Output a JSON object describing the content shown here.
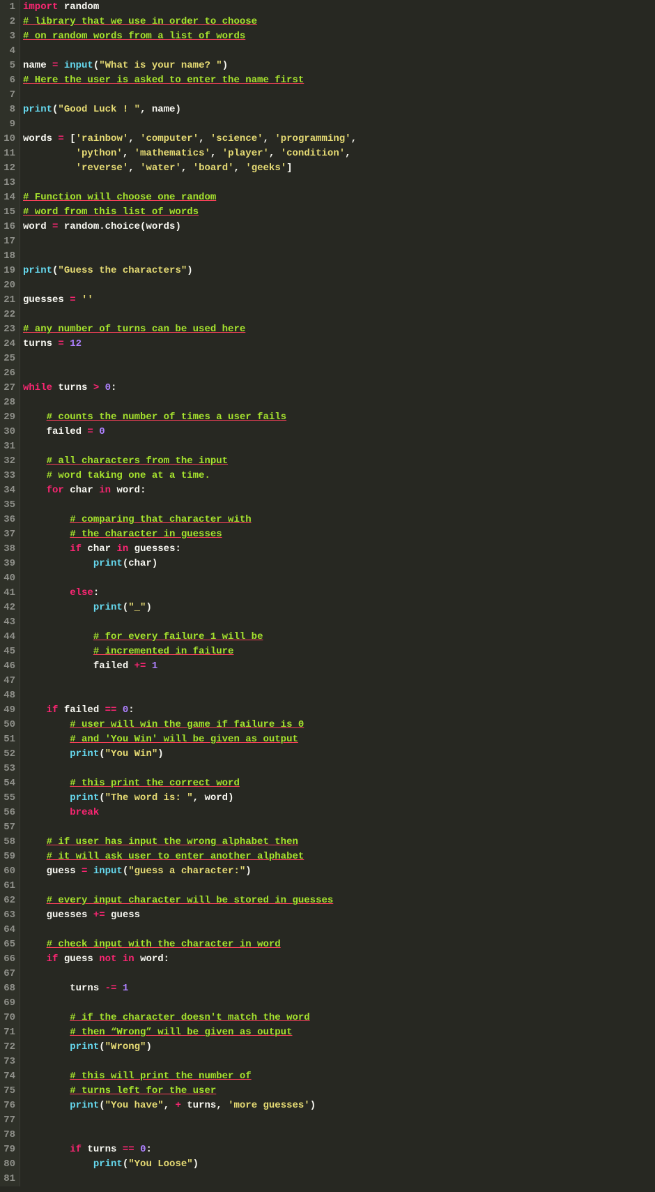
{
  "lines": [
    [
      [
        "import",
        "kw"
      ],
      [
        " random",
        "id"
      ]
    ],
    [
      [
        "# library that we use in order to choose",
        "sq"
      ]
    ],
    [
      [
        "# on random words from a list of words",
        "sq"
      ]
    ],
    [],
    [
      [
        "name ",
        "id"
      ],
      [
        "=",
        "op"
      ],
      [
        " ",
        "id"
      ],
      [
        "input",
        "fn"
      ],
      [
        "(",
        "id"
      ],
      [
        "\"What is your name? \"",
        "str"
      ],
      [
        ")",
        "id"
      ]
    ],
    [
      [
        "# Here the user is asked to enter the name first",
        "sq"
      ]
    ],
    [],
    [
      [
        "print",
        "fn"
      ],
      [
        "(",
        "id"
      ],
      [
        "\"Good Luck ! \"",
        "str"
      ],
      [
        ", name)",
        "id"
      ]
    ],
    [],
    [
      [
        "words ",
        "id"
      ],
      [
        "=",
        "op"
      ],
      [
        " [",
        "id"
      ],
      [
        "'rainbow'",
        "str"
      ],
      [
        ", ",
        "id"
      ],
      [
        "'computer'",
        "str"
      ],
      [
        ", ",
        "id"
      ],
      [
        "'science'",
        "str"
      ],
      [
        ", ",
        "id"
      ],
      [
        "'programming'",
        "str"
      ],
      [
        ",",
        "id"
      ]
    ],
    [
      [
        "         ",
        "id"
      ],
      [
        "'python'",
        "str"
      ],
      [
        ", ",
        "id"
      ],
      [
        "'mathematics'",
        "str"
      ],
      [
        ", ",
        "id"
      ],
      [
        "'player'",
        "str"
      ],
      [
        ", ",
        "id"
      ],
      [
        "'condition'",
        "str"
      ],
      [
        ",",
        "id"
      ]
    ],
    [
      [
        "         ",
        "id"
      ],
      [
        "'reverse'",
        "str"
      ],
      [
        ", ",
        "id"
      ],
      [
        "'water'",
        "str"
      ],
      [
        ", ",
        "id"
      ],
      [
        "'board'",
        "str"
      ],
      [
        ", ",
        "id"
      ],
      [
        "'geeks'",
        "str"
      ],
      [
        "]",
        "id"
      ]
    ],
    [],
    [
      [
        "# Function will choose one random",
        "sq"
      ]
    ],
    [
      [
        "# word from this list of words",
        "sq"
      ]
    ],
    [
      [
        "word ",
        "id"
      ],
      [
        "=",
        "op"
      ],
      [
        " random.choice(words)",
        "id"
      ]
    ],
    [],
    [],
    [
      [
        "print",
        "fn"
      ],
      [
        "(",
        "id"
      ],
      [
        "\"Guess the characters\"",
        "str"
      ],
      [
        ")",
        "id"
      ]
    ],
    [],
    [
      [
        "guesses ",
        "id"
      ],
      [
        "=",
        "op"
      ],
      [
        " ",
        "id"
      ],
      [
        "''",
        "str"
      ]
    ],
    [],
    [
      [
        "# any number of turns can be used here",
        "sq"
      ]
    ],
    [
      [
        "turns ",
        "id"
      ],
      [
        "=",
        "op"
      ],
      [
        " ",
        "id"
      ],
      [
        "12",
        "num"
      ]
    ],
    [],
    [],
    [
      [
        "while",
        "kw"
      ],
      [
        " turns ",
        "id"
      ],
      [
        ">",
        "op"
      ],
      [
        " ",
        "id"
      ],
      [
        "0",
        "num"
      ],
      [
        ":",
        "id"
      ]
    ],
    [],
    [
      [
        "    ",
        "id"
      ],
      [
        "# counts the number of times a user fails",
        "sq"
      ]
    ],
    [
      [
        "    failed ",
        "id"
      ],
      [
        "=",
        "op"
      ],
      [
        " ",
        "id"
      ],
      [
        "0",
        "num"
      ]
    ],
    [],
    [
      [
        "    ",
        "id"
      ],
      [
        "# all characters from the input",
        "sq"
      ]
    ],
    [
      [
        "    ",
        "id"
      ],
      [
        "# word taking one at a time.",
        "sq2"
      ]
    ],
    [
      [
        "    ",
        "id"
      ],
      [
        "for",
        "kw"
      ],
      [
        " char ",
        "id"
      ],
      [
        "in",
        "kw"
      ],
      [
        " word:",
        "id"
      ]
    ],
    [],
    [
      [
        "        ",
        "id"
      ],
      [
        "# comparing that character with",
        "sq"
      ]
    ],
    [
      [
        "        ",
        "id"
      ],
      [
        "# the character in guesses",
        "sq"
      ]
    ],
    [
      [
        "        ",
        "id"
      ],
      [
        "if",
        "kw"
      ],
      [
        " char ",
        "id"
      ],
      [
        "in",
        "kw"
      ],
      [
        " guesses:",
        "id"
      ]
    ],
    [
      [
        "            ",
        "id"
      ],
      [
        "print",
        "fn"
      ],
      [
        "(char)",
        "id"
      ]
    ],
    [],
    [
      [
        "        ",
        "id"
      ],
      [
        "else",
        "kw"
      ],
      [
        ":",
        "id"
      ]
    ],
    [
      [
        "            ",
        "id"
      ],
      [
        "print",
        "fn"
      ],
      [
        "(",
        "id"
      ],
      [
        "\"_\"",
        "str"
      ],
      [
        ")",
        "id"
      ]
    ],
    [],
    [
      [
        "            ",
        "id"
      ],
      [
        "# for every failure 1 will be",
        "sq"
      ]
    ],
    [
      [
        "            ",
        "id"
      ],
      [
        "# incremented in failure",
        "sq"
      ]
    ],
    [
      [
        "            failed ",
        "id"
      ],
      [
        "+=",
        "op"
      ],
      [
        " ",
        "id"
      ],
      [
        "1",
        "num"
      ]
    ],
    [],
    [],
    [
      [
        "    ",
        "id"
      ],
      [
        "if",
        "kw"
      ],
      [
        " failed ",
        "id"
      ],
      [
        "==",
        "op"
      ],
      [
        " ",
        "id"
      ],
      [
        "0",
        "num"
      ],
      [
        ":",
        "id"
      ]
    ],
    [
      [
        "        ",
        "id"
      ],
      [
        "# user will win the game if failure is 0",
        "sq"
      ]
    ],
    [
      [
        "        ",
        "id"
      ],
      [
        "# and 'You Win' will be given as output",
        "sq"
      ]
    ],
    [
      [
        "        ",
        "id"
      ],
      [
        "print",
        "fn"
      ],
      [
        "(",
        "id"
      ],
      [
        "\"You Win\"",
        "str"
      ],
      [
        ")",
        "id"
      ]
    ],
    [],
    [
      [
        "        ",
        "id"
      ],
      [
        "# this print the correct word",
        "sq"
      ]
    ],
    [
      [
        "        ",
        "id"
      ],
      [
        "print",
        "fn"
      ],
      [
        "(",
        "id"
      ],
      [
        "\"The word is: \"",
        "str"
      ],
      [
        ", word)",
        "id"
      ]
    ],
    [
      [
        "        ",
        "id"
      ],
      [
        "break",
        "kw"
      ]
    ],
    [],
    [
      [
        "    ",
        "id"
      ],
      [
        "# if user has input the wrong alphabet then",
        "sq"
      ]
    ],
    [
      [
        "    ",
        "id"
      ],
      [
        "# it will ask user to enter another alphabet",
        "sq"
      ]
    ],
    [
      [
        "    guess ",
        "id"
      ],
      [
        "=",
        "op"
      ],
      [
        " ",
        "id"
      ],
      [
        "input",
        "fn"
      ],
      [
        "(",
        "id"
      ],
      [
        "\"guess a character:\"",
        "str"
      ],
      [
        ")",
        "id"
      ]
    ],
    [],
    [
      [
        "    ",
        "id"
      ],
      [
        "# every input character will be stored in guesses",
        "sq"
      ]
    ],
    [
      [
        "    guesses ",
        "id"
      ],
      [
        "+=",
        "op"
      ],
      [
        " guess",
        "id"
      ]
    ],
    [],
    [
      [
        "    ",
        "id"
      ],
      [
        "# check input with the character in word",
        "sq"
      ]
    ],
    [
      [
        "    ",
        "id"
      ],
      [
        "if",
        "kw"
      ],
      [
        " guess ",
        "id"
      ],
      [
        "not",
        "kw"
      ],
      [
        " ",
        "id"
      ],
      [
        "in",
        "kw"
      ],
      [
        " word:",
        "id"
      ]
    ],
    [],
    [
      [
        "        turns ",
        "id"
      ],
      [
        "-=",
        "op"
      ],
      [
        " ",
        "id"
      ],
      [
        "1",
        "num"
      ]
    ],
    [],
    [
      [
        "        ",
        "id"
      ],
      [
        "# if the character doesn't match the word",
        "sq"
      ]
    ],
    [
      [
        "        ",
        "id"
      ],
      [
        "# then “Wrong” will be given as output",
        "sq"
      ]
    ],
    [
      [
        "        ",
        "id"
      ],
      [
        "print",
        "fn"
      ],
      [
        "(",
        "id"
      ],
      [
        "\"Wrong\"",
        "str"
      ],
      [
        ")",
        "id"
      ]
    ],
    [],
    [
      [
        "        ",
        "id"
      ],
      [
        "# this will print the number of",
        "sq"
      ]
    ],
    [
      [
        "        ",
        "id"
      ],
      [
        "# turns left for the user",
        "sq"
      ]
    ],
    [
      [
        "        ",
        "id"
      ],
      [
        "print",
        "fn"
      ],
      [
        "(",
        "id"
      ],
      [
        "\"You have\"",
        "str"
      ],
      [
        ", ",
        "id"
      ],
      [
        "+",
        "op"
      ],
      [
        " turns, ",
        "id"
      ],
      [
        "'more guesses'",
        "str"
      ],
      [
        ")",
        "id"
      ]
    ],
    [],
    [],
    [
      [
        "        ",
        "id"
      ],
      [
        "if",
        "kw"
      ],
      [
        " turns ",
        "id"
      ],
      [
        "==",
        "op"
      ],
      [
        " ",
        "id"
      ],
      [
        "0",
        "num"
      ],
      [
        ":",
        "id"
      ]
    ],
    [
      [
        "            ",
        "id"
      ],
      [
        "print",
        "fn"
      ],
      [
        "(",
        "id"
      ],
      [
        "\"You Loose\"",
        "str"
      ],
      [
        ")",
        "id"
      ]
    ],
    []
  ]
}
